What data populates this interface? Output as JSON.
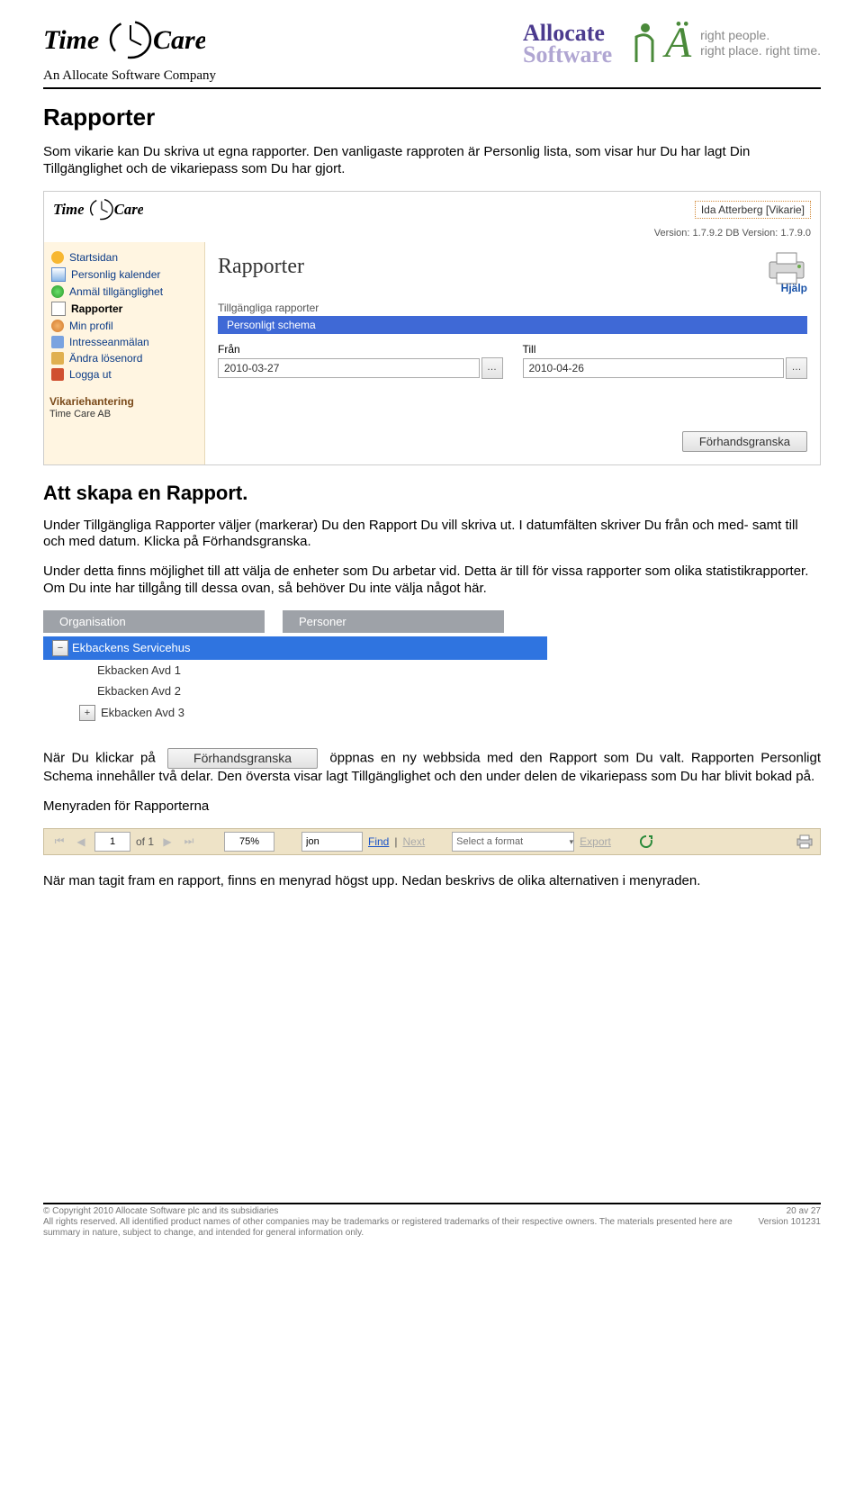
{
  "header": {
    "timecare_alt": "Time Care",
    "sub_company": "An Allocate Software Company",
    "allocate_alt": "Allocate Software",
    "tag1": "right people.",
    "tag2": "right place. right time."
  },
  "doc": {
    "h1": "Rapporter",
    "p1": "Som vikarie kan Du skriva ut egna rapporter. Den vanligaste rapproten är Personlig lista, som visar hur Du har lagt Din Tillgänglighet och de vikariepass som Du har gjort.",
    "h2": "Att skapa en Rapport.",
    "p2": "Under Tillgängliga Rapporter väljer (markerar) Du den Rapport Du vill skriva ut. I datumfälten skriver Du från och med- samt till och med datum. Klicka på Förhandsgranska.",
    "p3": "Under detta finns möjlighet till att välja de enheter som Du arbetar vid. Detta är till för vissa rapporter som olika statistikrapporter. Om Du inte har tillgång till dessa ovan, så behöver Du inte välja något här.",
    "p4a": "När Du klickar på ",
    "p4_btn": "Förhandsgranska",
    "p4b": " öppnas en ny webbsida med den Rapport som Du valt. Rapporten Personligt Schema innehåller två delar. Den översta visar lagt Tillgänglighet och den under delen de vikariepass som Du har blivit bokad på.",
    "p5": "Menyraden för Rapporterna",
    "p6": "När man tagit fram en rapport, finns en menyrad högst upp. Nedan beskrivs de olika alternativen i menyraden."
  },
  "shot": {
    "user": "Ida Atterberg [Vikarie]",
    "version": "Version: 1.7.9.2   DB Version: 1.7.9.0",
    "sidebar": [
      "Startsidan",
      "Personlig kalender",
      "Anmäl tillgänglighet",
      "Rapporter",
      "Min profil",
      "Intresseanmälan",
      "Ändra lösenord",
      "Logga ut"
    ],
    "side_group_hdr": "Vikariehantering",
    "side_group_sub": "Time Care AB",
    "main_title": "Rapporter",
    "help": "Hjälp",
    "avail_label": "Tillgängliga rapporter",
    "selected_report": "Personligt schema",
    "from_lbl": "Från",
    "till_lbl": "Till",
    "from_val": "2010-03-27",
    "till_val": "2010-04-26",
    "preview_btn": "Förhandsgranska"
  },
  "org": {
    "th1": "Organisation",
    "th2": "Personer",
    "root": "Ekbackens Servicehus",
    "children": [
      "Ekbacken Avd 1",
      "Ekbacken Avd 2",
      "Ekbacken Avd 3"
    ]
  },
  "menubar": {
    "page": "1",
    "of_lbl": "of 1",
    "zoom": "75%",
    "search": "jon",
    "find": "Find",
    "next": "Next",
    "format": "Select a format",
    "export": "Export"
  },
  "footer": {
    "copy": "© Copyright 2010 Allocate Software plc and its subsidiaries",
    "line2": "All rights reserved. All identified product names of other companies may be trademarks or registered trademarks of their respective owners. The materials presented here are summary in nature, subject to change, and intended for general information only.",
    "page": "20 av 27",
    "ver": "Version 101231"
  }
}
